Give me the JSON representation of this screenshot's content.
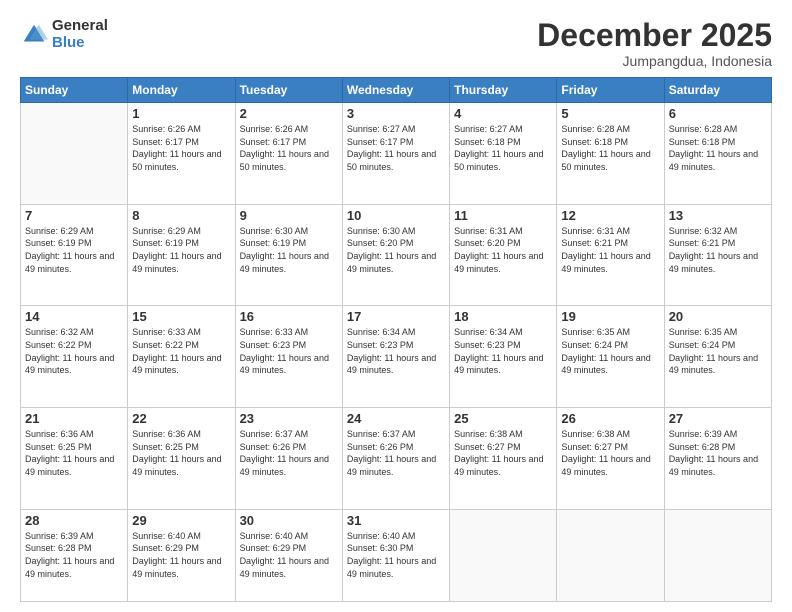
{
  "logo": {
    "general": "General",
    "blue": "Blue"
  },
  "header": {
    "month": "December 2025",
    "location": "Jumpangdua, Indonesia"
  },
  "days_of_week": [
    "Sunday",
    "Monday",
    "Tuesday",
    "Wednesday",
    "Thursday",
    "Friday",
    "Saturday"
  ],
  "weeks": [
    [
      {
        "day": "",
        "empty": true
      },
      {
        "day": "1",
        "sunrise": "6:26 AM",
        "sunset": "6:17 PM",
        "daylight": "11 hours and 50 minutes."
      },
      {
        "day": "2",
        "sunrise": "6:26 AM",
        "sunset": "6:17 PM",
        "daylight": "11 hours and 50 minutes."
      },
      {
        "day": "3",
        "sunrise": "6:27 AM",
        "sunset": "6:17 PM",
        "daylight": "11 hours and 50 minutes."
      },
      {
        "day": "4",
        "sunrise": "6:27 AM",
        "sunset": "6:18 PM",
        "daylight": "11 hours and 50 minutes."
      },
      {
        "day": "5",
        "sunrise": "6:28 AM",
        "sunset": "6:18 PM",
        "daylight": "11 hours and 50 minutes."
      },
      {
        "day": "6",
        "sunrise": "6:28 AM",
        "sunset": "6:18 PM",
        "daylight": "11 hours and 49 minutes."
      }
    ],
    [
      {
        "day": "7",
        "sunrise": "6:29 AM",
        "sunset": "6:19 PM",
        "daylight": "11 hours and 49 minutes."
      },
      {
        "day": "8",
        "sunrise": "6:29 AM",
        "sunset": "6:19 PM",
        "daylight": "11 hours and 49 minutes."
      },
      {
        "day": "9",
        "sunrise": "6:30 AM",
        "sunset": "6:19 PM",
        "daylight": "11 hours and 49 minutes."
      },
      {
        "day": "10",
        "sunrise": "6:30 AM",
        "sunset": "6:20 PM",
        "daylight": "11 hours and 49 minutes."
      },
      {
        "day": "11",
        "sunrise": "6:31 AM",
        "sunset": "6:20 PM",
        "daylight": "11 hours and 49 minutes."
      },
      {
        "day": "12",
        "sunrise": "6:31 AM",
        "sunset": "6:21 PM",
        "daylight": "11 hours and 49 minutes."
      },
      {
        "day": "13",
        "sunrise": "6:32 AM",
        "sunset": "6:21 PM",
        "daylight": "11 hours and 49 minutes."
      }
    ],
    [
      {
        "day": "14",
        "sunrise": "6:32 AM",
        "sunset": "6:22 PM",
        "daylight": "11 hours and 49 minutes."
      },
      {
        "day": "15",
        "sunrise": "6:33 AM",
        "sunset": "6:22 PM",
        "daylight": "11 hours and 49 minutes."
      },
      {
        "day": "16",
        "sunrise": "6:33 AM",
        "sunset": "6:23 PM",
        "daylight": "11 hours and 49 minutes."
      },
      {
        "day": "17",
        "sunrise": "6:34 AM",
        "sunset": "6:23 PM",
        "daylight": "11 hours and 49 minutes."
      },
      {
        "day": "18",
        "sunrise": "6:34 AM",
        "sunset": "6:23 PM",
        "daylight": "11 hours and 49 minutes."
      },
      {
        "day": "19",
        "sunrise": "6:35 AM",
        "sunset": "6:24 PM",
        "daylight": "11 hours and 49 minutes."
      },
      {
        "day": "20",
        "sunrise": "6:35 AM",
        "sunset": "6:24 PM",
        "daylight": "11 hours and 49 minutes."
      }
    ],
    [
      {
        "day": "21",
        "sunrise": "6:36 AM",
        "sunset": "6:25 PM",
        "daylight": "11 hours and 49 minutes."
      },
      {
        "day": "22",
        "sunrise": "6:36 AM",
        "sunset": "6:25 PM",
        "daylight": "11 hours and 49 minutes."
      },
      {
        "day": "23",
        "sunrise": "6:37 AM",
        "sunset": "6:26 PM",
        "daylight": "11 hours and 49 minutes."
      },
      {
        "day": "24",
        "sunrise": "6:37 AM",
        "sunset": "6:26 PM",
        "daylight": "11 hours and 49 minutes."
      },
      {
        "day": "25",
        "sunrise": "6:38 AM",
        "sunset": "6:27 PM",
        "daylight": "11 hours and 49 minutes."
      },
      {
        "day": "26",
        "sunrise": "6:38 AM",
        "sunset": "6:27 PM",
        "daylight": "11 hours and 49 minutes."
      },
      {
        "day": "27",
        "sunrise": "6:39 AM",
        "sunset": "6:28 PM",
        "daylight": "11 hours and 49 minutes."
      }
    ],
    [
      {
        "day": "28",
        "sunrise": "6:39 AM",
        "sunset": "6:28 PM",
        "daylight": "11 hours and 49 minutes."
      },
      {
        "day": "29",
        "sunrise": "6:40 AM",
        "sunset": "6:29 PM",
        "daylight": "11 hours and 49 minutes."
      },
      {
        "day": "30",
        "sunrise": "6:40 AM",
        "sunset": "6:29 PM",
        "daylight": "11 hours and 49 minutes."
      },
      {
        "day": "31",
        "sunrise": "6:40 AM",
        "sunset": "6:30 PM",
        "daylight": "11 hours and 49 minutes."
      },
      {
        "day": "",
        "empty": true
      },
      {
        "day": "",
        "empty": true
      },
      {
        "day": "",
        "empty": true
      }
    ]
  ]
}
